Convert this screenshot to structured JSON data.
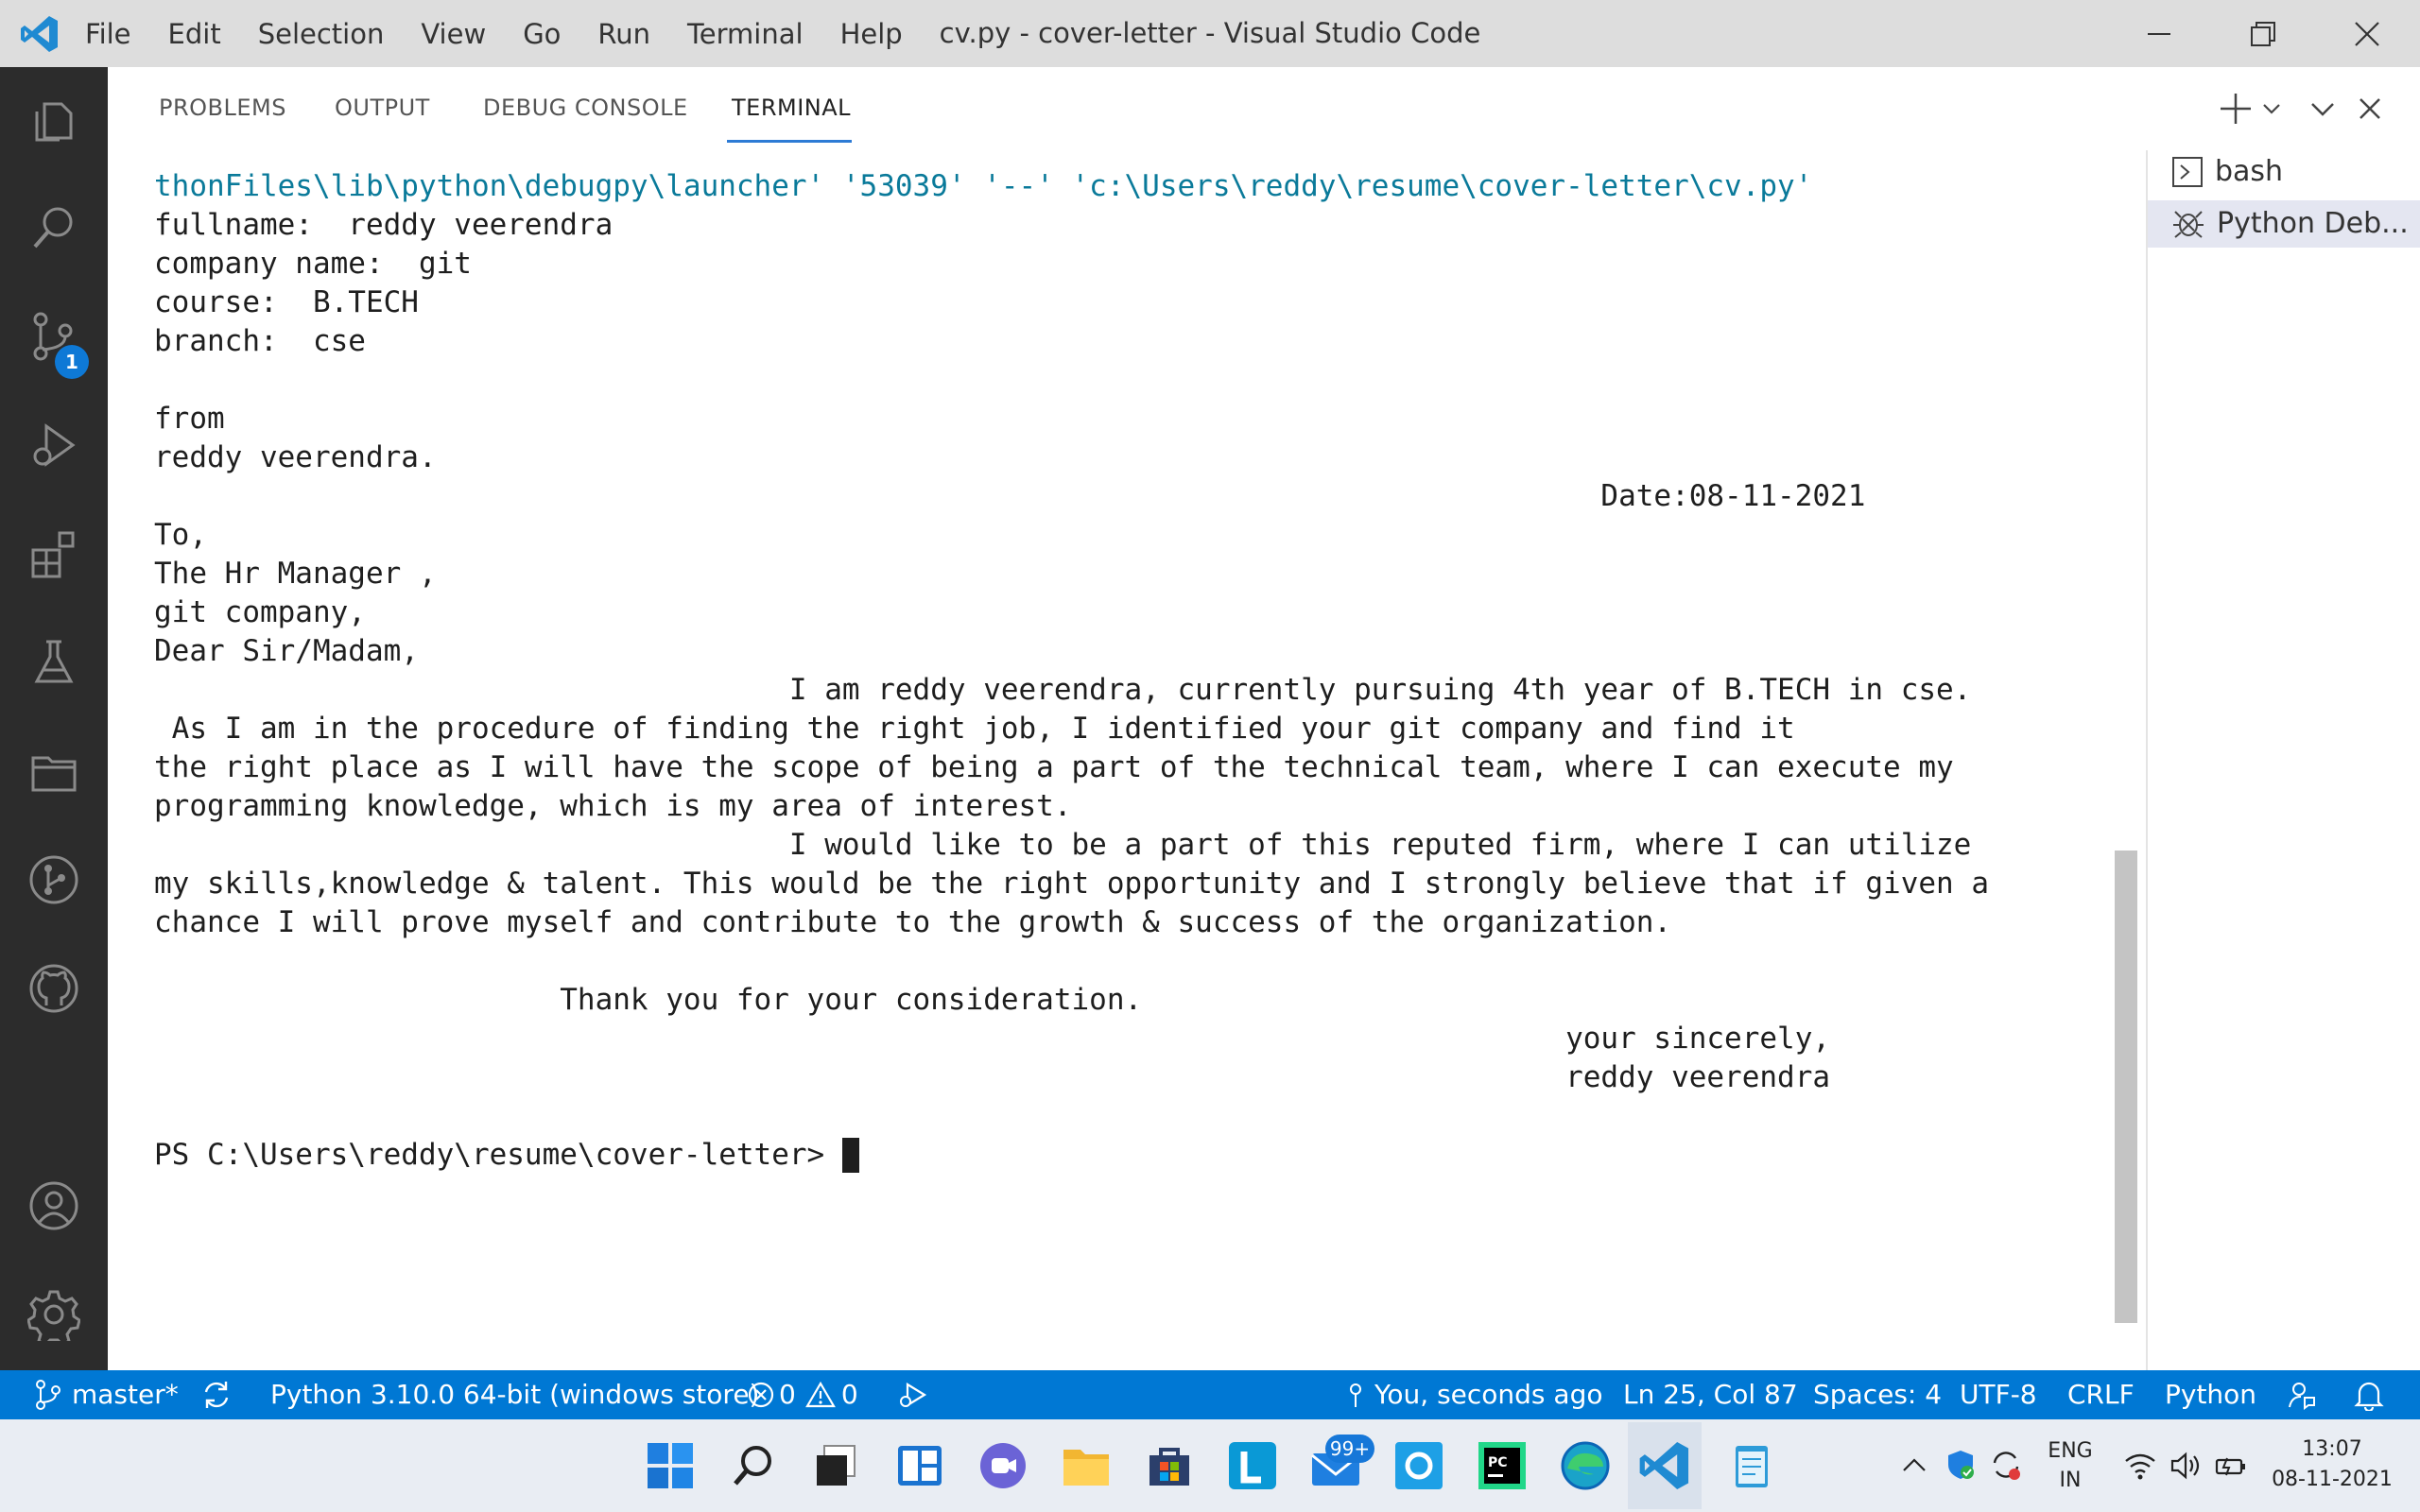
{
  "window": {
    "title": "cv.py - cover-letter - Visual Studio Code",
    "menu": [
      "File",
      "Edit",
      "Selection",
      "View",
      "Go",
      "Run",
      "Terminal",
      "Help"
    ]
  },
  "activity_bar": {
    "source_control_badge": "1"
  },
  "panel": {
    "tabs": [
      "PROBLEMS",
      "OUTPUT",
      "DEBUG CONSOLE",
      "TERMINAL"
    ],
    "active_tab": "TERMINAL"
  },
  "terminal": {
    "first_line": "thonFiles\\lib\\python\\debugpy\\launcher' '53039' '--' 'c:\\Users\\reddy\\resume\\cover-letter\\cv.py'",
    "lines": [
      "fullname:  reddy veerendra",
      "company name:  git",
      "course:  B.TECH",
      "branch:  cse",
      "",
      "from",
      "reddy veerendra.",
      "                                                                                  Date:08-11-2021",
      "To,",
      "The Hr Manager ,",
      "git company,",
      "Dear Sir/Madam,",
      "                                    I am reddy veerendra, currently pursuing 4th year of B.TECH in cse.",
      " As I am in the procedure of finding the right job, I identified your git company and find it",
      "the right place as I will have the scope of being a part of the technical team, where I can execute my",
      "programming knowledge, which is my area of interest.",
      "                                    I would like to be a part of this reputed firm, where I can utilize",
      "my skills,knowledge & talent. This would be the right opportunity and I strongly believe that if given a",
      "chance I will prove myself and contribute to the growth & success of the organization.",
      "",
      "                       Thank you for your consideration.",
      "                                                                                your sincerely,",
      "                                                                                reddy veerendra",
      "",
      "PS C:\\Users\\reddy\\resume\\cover-letter> "
    ],
    "instances": [
      "bash",
      "Python Deb..."
    ]
  },
  "status_bar": {
    "branch": "master*",
    "interpreter": "Python 3.10.0 64-bit (windows store)",
    "errors": "0",
    "warnings": "0",
    "blame": "You, seconds ago",
    "cursor_position": "Ln 25, Col 87",
    "indentation": "Spaces: 4",
    "encoding": "UTF-8",
    "line_ending": "CRLF",
    "language": "Python"
  },
  "taskbar": {
    "mail_badge": "99+",
    "language": "ENG",
    "region": "IN",
    "time": "13:07",
    "date": "08-11-2021"
  },
  "colors": {
    "accent": "#0078d4",
    "activity_bar": "#2c2c2c",
    "terminal_link": "#0a7a9a",
    "badge": "#0e79d6"
  }
}
